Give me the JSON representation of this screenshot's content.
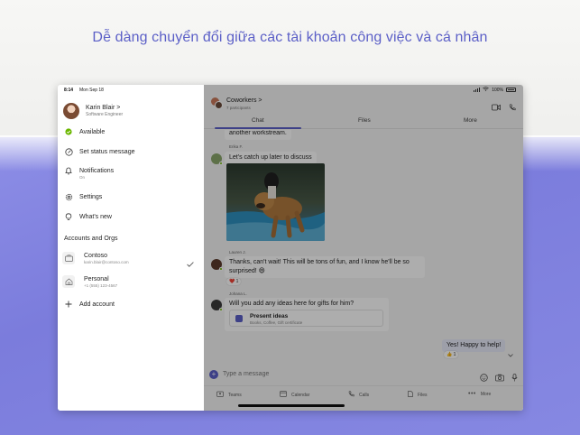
{
  "headline": "Dễ dàng chuyển đổi giữa các tài khoản công việc và cá nhân",
  "status_bar": {
    "time": "8:14",
    "date": "Mon Sep 18",
    "battery": "100%"
  },
  "profile": {
    "name": "Karin Blair",
    "chevron": ">",
    "role": "Software Engineer"
  },
  "menu": {
    "available": "Available",
    "set_status": "Set status message",
    "notifications": "Notifications",
    "notifications_sub": "On",
    "settings": "Settings",
    "whats_new": "What's new"
  },
  "accounts": {
    "title": "Accounts and Orgs",
    "items": [
      {
        "name": "Contoso",
        "sub": "karin.blair@contoso.com",
        "selected": true
      },
      {
        "name": "Personal",
        "sub": "+1 (555) 123-4567",
        "selected": false
      }
    ],
    "add_label": "Add account"
  },
  "chat": {
    "title": "Coworkers",
    "chevron": ">",
    "participants": "7 participants",
    "tabs": [
      "Chat",
      "Files",
      "More"
    ],
    "active_tab": 0,
    "messages": {
      "m0_text": "another workstream.",
      "m1_sender": "Erika F.",
      "m1_text": "Let's catch up later to discuss",
      "m2_sender": "Lauren J.",
      "m2_line1": "Thanks, can't wait! This will be tons of fun, and I know he'll be so",
      "m2_line2": "surprised! 😄",
      "m2_reaction": "❤️ 1",
      "m3_sender": "Johana L.",
      "m3_text": "Will you add any ideas here for gifts for him?",
      "card_title": "Present ideas",
      "card_sub": "Books, Coffee, Gift certificate",
      "my_text": "Yes! Happy to help!",
      "my_reaction": "👍 1"
    },
    "compose_placeholder": "Type a message"
  },
  "bottom_nav": [
    "Teams",
    "Calendar",
    "Calls",
    "Files",
    "More"
  ],
  "colors": {
    "brand": "#5b5fc7",
    "presence_available": "#6bb700",
    "background_purple": "#8385e0"
  }
}
